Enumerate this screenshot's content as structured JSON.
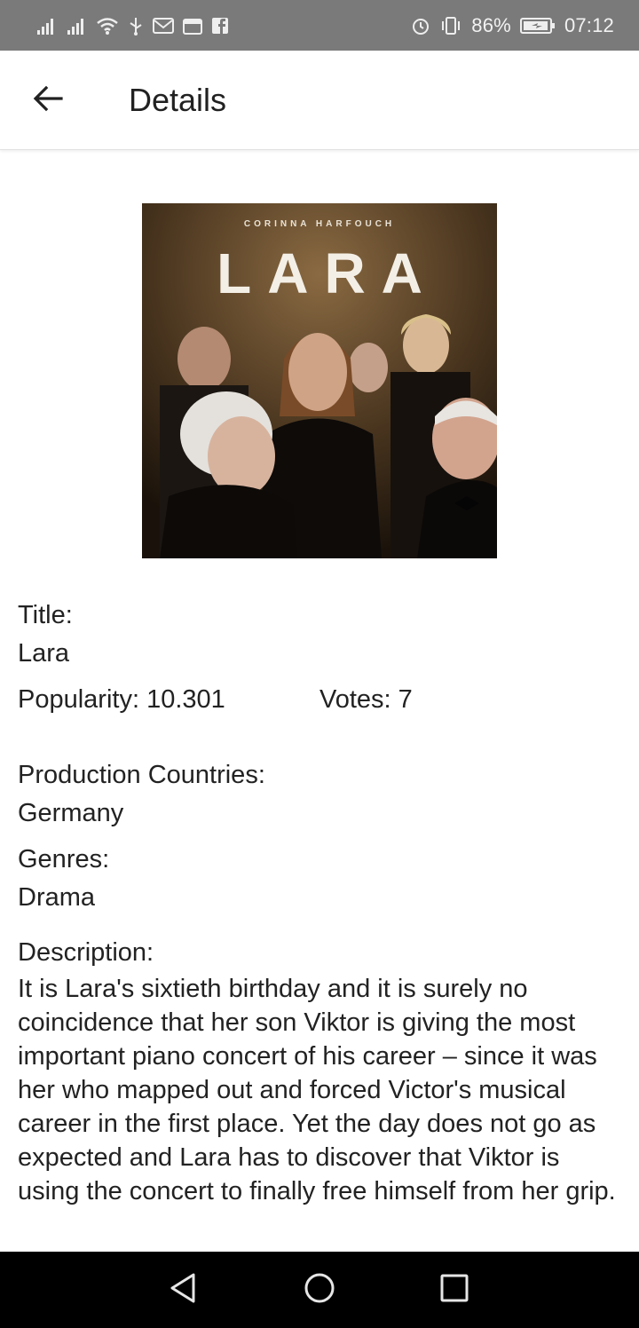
{
  "status_bar": {
    "battery_percent": "86%",
    "time": "07:12",
    "icons": [
      "signal-icon",
      "signal-icon",
      "wifi-icon",
      "usb-icon",
      "mail-icon",
      "calendar-icon",
      "facebook-icon",
      "alarm-icon",
      "vibrate-icon",
      "battery-icon"
    ]
  },
  "app_bar": {
    "title": "Details",
    "back_icon": "arrow-back-icon"
  },
  "poster": {
    "author": "CORINNA HARFOUCH",
    "title": "LARA"
  },
  "details": {
    "title_label": "Title:",
    "title_value": "Lara",
    "popularity": "Popularity: 10.301",
    "votes": "Votes: 7",
    "countries_label": "Production Countries:",
    "countries_value": "Germany",
    "genres_label": "Genres:",
    "genres_value": "Drama",
    "description_label": "Description:",
    "description_value": "It is Lara's sixtieth birthday and it is surely no coincidence that her son Viktor is giving the most important piano concert of his career – since it was her who mapped out and forced Victor's musical career in the first place. Yet the day does not go as expected and Lara has to discover that Viktor is using the concert to finally free himself from her grip."
  },
  "nav_bar": {
    "icons": [
      "back-triangle-icon",
      "home-circle-icon",
      "recents-square-icon"
    ]
  }
}
